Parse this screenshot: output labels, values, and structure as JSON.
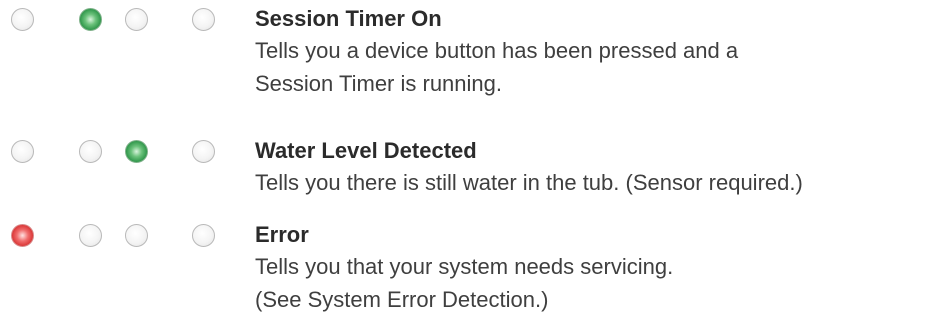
{
  "indicators": [
    {
      "title": "Session Timer On",
      "description_lines": [
        "Tells you a device button has been pressed and a",
        "Session Timer is running."
      ],
      "leds": [
        "off",
        "green",
        "off",
        "off"
      ]
    },
    {
      "title": "Water Level Detected",
      "description_lines": [
        "Tells you there is still water in the tub. (Sensor required.)"
      ],
      "leds": [
        "off",
        "off",
        "green",
        "off"
      ]
    },
    {
      "title": "Error",
      "description_lines": [
        "Tells you that your system needs servicing.",
        "(See System Error Detection.)"
      ],
      "leds": [
        "red",
        "off",
        "off",
        "off"
      ]
    }
  ],
  "colors": {
    "led_off": "#f2f2f2",
    "led_green": "#2e9a4a",
    "led_red": "#e03a3a",
    "text": "#3a3a3a"
  }
}
